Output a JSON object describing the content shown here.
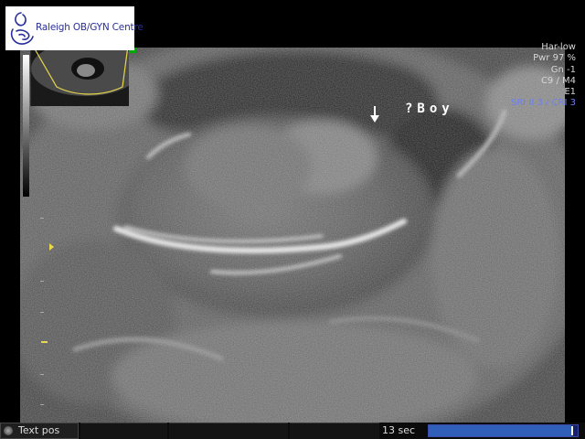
{
  "header": {
    "clinic_name": "Raleigh OB/GYN Centre"
  },
  "parameters": {
    "line1": "Har-low",
    "line2": "Pwr 97 %",
    "line3": "Gn -1",
    "line4": "C9 / M4",
    "line5": "E1",
    "line6": "SRI II 3 / CRI 3"
  },
  "annotation": {
    "text": "?Boy",
    "icon": "down-arrow-icon"
  },
  "bottom_bar": {
    "text_pos_label": "Text pos",
    "cine_time": "13 sec",
    "cine_progress_fraction": 0.96
  },
  "colors": {
    "logo_text": "#2a2f9a",
    "param_blue": "#6d7ff0",
    "marker_yellow": "#e8d84a",
    "progress_blue": "#2f5fb8"
  }
}
